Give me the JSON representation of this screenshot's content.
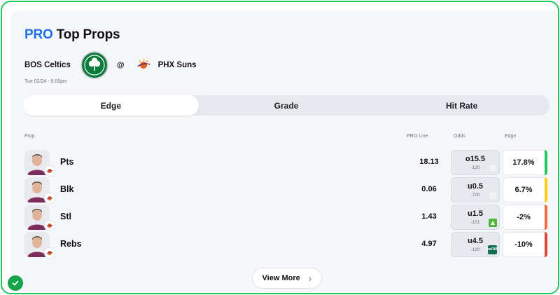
{
  "header": {
    "title_pro": "PRO",
    "title_rest": "Top Props"
  },
  "matchup": {
    "home_team": "BOS Celtics",
    "separator": "@",
    "away_team": "PHX Suns",
    "datetime": "Tue 02/24 - 9:00pm"
  },
  "tabs": [
    {
      "label": "Edge",
      "active": true
    },
    {
      "label": "Grade",
      "active": false
    },
    {
      "label": "Hit Rate",
      "active": false
    }
  ],
  "columns": {
    "prop": "Prop",
    "pro_line": "PRO Line",
    "odds": "Odds",
    "edge": "Edge"
  },
  "rows": [
    {
      "prop": "Pts",
      "pro_line": "18.13",
      "odds_line": "o15.5",
      "odds_price": "-120",
      "book_icon": "book-blank-icon",
      "edge": "17.8%",
      "edge_color": "#22c55e"
    },
    {
      "prop": "Blk",
      "pro_line": "0.06",
      "odds_line": "u0.5",
      "odds_price": "-700",
      "book_icon": "book-blank-icon",
      "edge": "6.7%",
      "edge_color": "#facc15"
    },
    {
      "prop": "Stl",
      "pro_line": "1.43",
      "odds_line": "u1.5",
      "odds_price": "-151",
      "book_icon": "draftkings-icon",
      "edge": "-2%",
      "edge_color": "#ef6c45"
    },
    {
      "prop": "Rebs",
      "pro_line": "4.97",
      "odds_line": "u4.5",
      "odds_price": "-120",
      "book_icon": "bet365-icon",
      "edge": "-10%",
      "edge_color": "#d64b3a",
      "book_text": "bet365"
    }
  ],
  "footer": {
    "view_more": "View More"
  },
  "colors": {
    "accent": "#1d6fe6",
    "frame": "#22c55e",
    "celtics_green": "#0b7a3b",
    "suns_orange": "#e56020"
  }
}
